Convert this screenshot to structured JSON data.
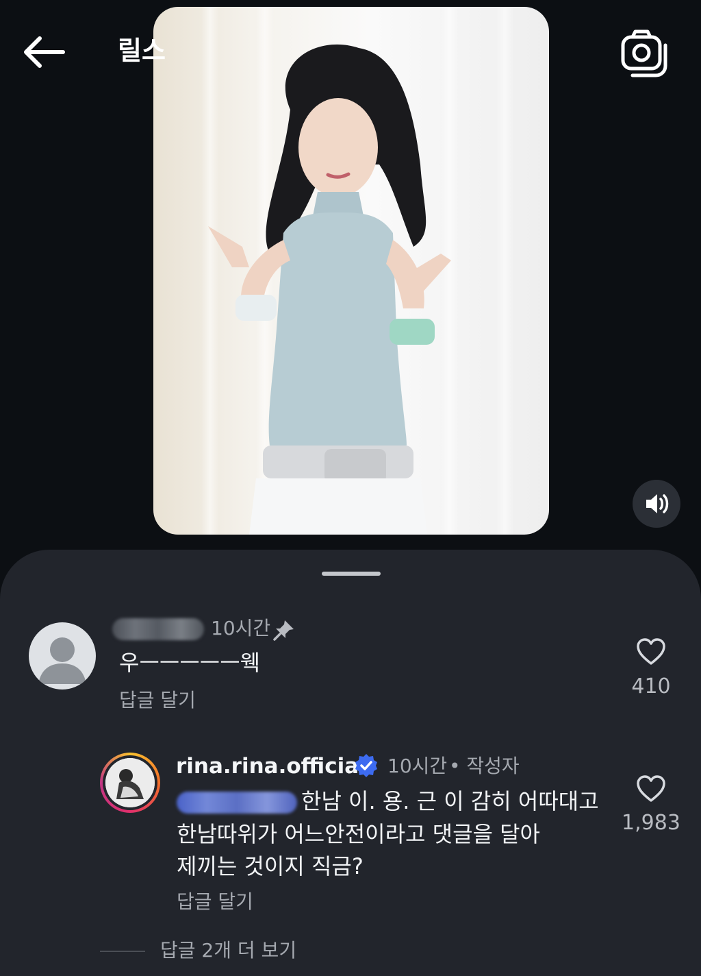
{
  "header": {
    "title": "릴스"
  },
  "comments": [
    {
      "time": "10시간",
      "text": "우ㅡㅡㅡㅡㅡ웩",
      "reply_label": "답글 달기",
      "likes": "410"
    },
    {
      "username": "rina.rina.official",
      "time": "10시간",
      "author_badge": "• 작성자",
      "text_line1": "한남 이. 용. 근 이 감히 어따대고",
      "text_line2": "한남따위가 어느안전이라고 댓글을 달아",
      "text_line3": "제끼는 것이지 직금?",
      "reply_label": "답글 달기",
      "likes": "1,983",
      "more_replies": "답글 2개 더 보기"
    }
  ],
  "colors": {
    "background": "#0c0f13",
    "sheet": "#22252c",
    "verified": "#3d6bf0",
    "muted_text": "#a5a9b0"
  },
  "icons": [
    "back-arrow-icon",
    "camera-icon",
    "volume-icon",
    "pin-icon",
    "heart-icon",
    "verified-badge-icon",
    "default-avatar-icon"
  ]
}
